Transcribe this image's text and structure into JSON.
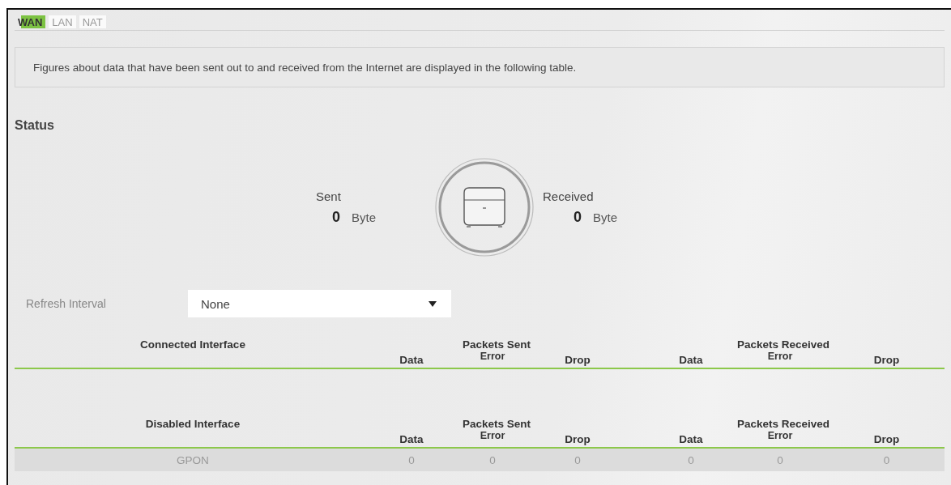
{
  "tabs": [
    {
      "label": "WAN",
      "selected": true
    },
    {
      "label": "LAN",
      "selected": false
    },
    {
      "label": "NAT",
      "selected": false
    }
  ],
  "description": "Figures about data that have been sent out to and received from the Internet are displayed in the following table.",
  "status": {
    "title": "Status",
    "sent": {
      "label": "Sent",
      "value": "0",
      "unit": "Byte"
    },
    "received": {
      "label": "Received",
      "value": "0",
      "unit": "Byte"
    }
  },
  "refresh_interval": {
    "label": "Refresh Interval",
    "value": "None"
  },
  "tables": [
    {
      "interface_header": "Connected Interface",
      "groups": [
        {
          "label": "Packets Sent",
          "columns": [
            "Data",
            "Error",
            "Drop"
          ]
        },
        {
          "label": "Packets Received",
          "columns": [
            "Data",
            "Error",
            "Drop"
          ]
        }
      ]
    },
    {
      "interface_header": "Disabled Interface",
      "groups": [
        {
          "label": "Packets Sent",
          "columns": [
            "Data",
            "Error",
            "Drop"
          ]
        },
        {
          "label": "Packets Received",
          "columns": [
            "Data",
            "Error",
            "Drop"
          ]
        }
      ],
      "rows": [
        {
          "interface": "GPON",
          "values": [
            "0",
            "0",
            "0",
            "0",
            "0",
            "0"
          ]
        }
      ]
    }
  ]
}
